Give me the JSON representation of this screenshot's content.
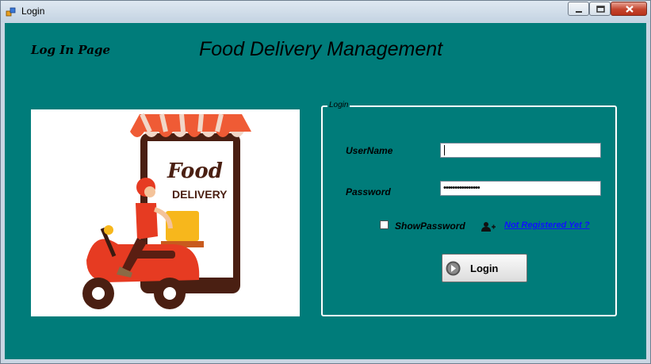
{
  "window": {
    "title": "Login"
  },
  "header": {
    "page_label": "Log In Page",
    "app_title": "Food Delivery Management"
  },
  "illustration": {
    "logo_word_1": "Food",
    "logo_word_2": "DELIVERY"
  },
  "login_group": {
    "legend": "Login",
    "username_label": "UserName",
    "username_value": "",
    "password_label": "Password",
    "password_value": "••••••••••••••••",
    "show_password_label": "ShowPassword",
    "show_password_checked": false,
    "register_link": "Not Registered Yet ?",
    "login_button": "Login"
  },
  "colors": {
    "background": "#007c7a",
    "link": "#1010ff",
    "title_close": "#c4452e"
  }
}
